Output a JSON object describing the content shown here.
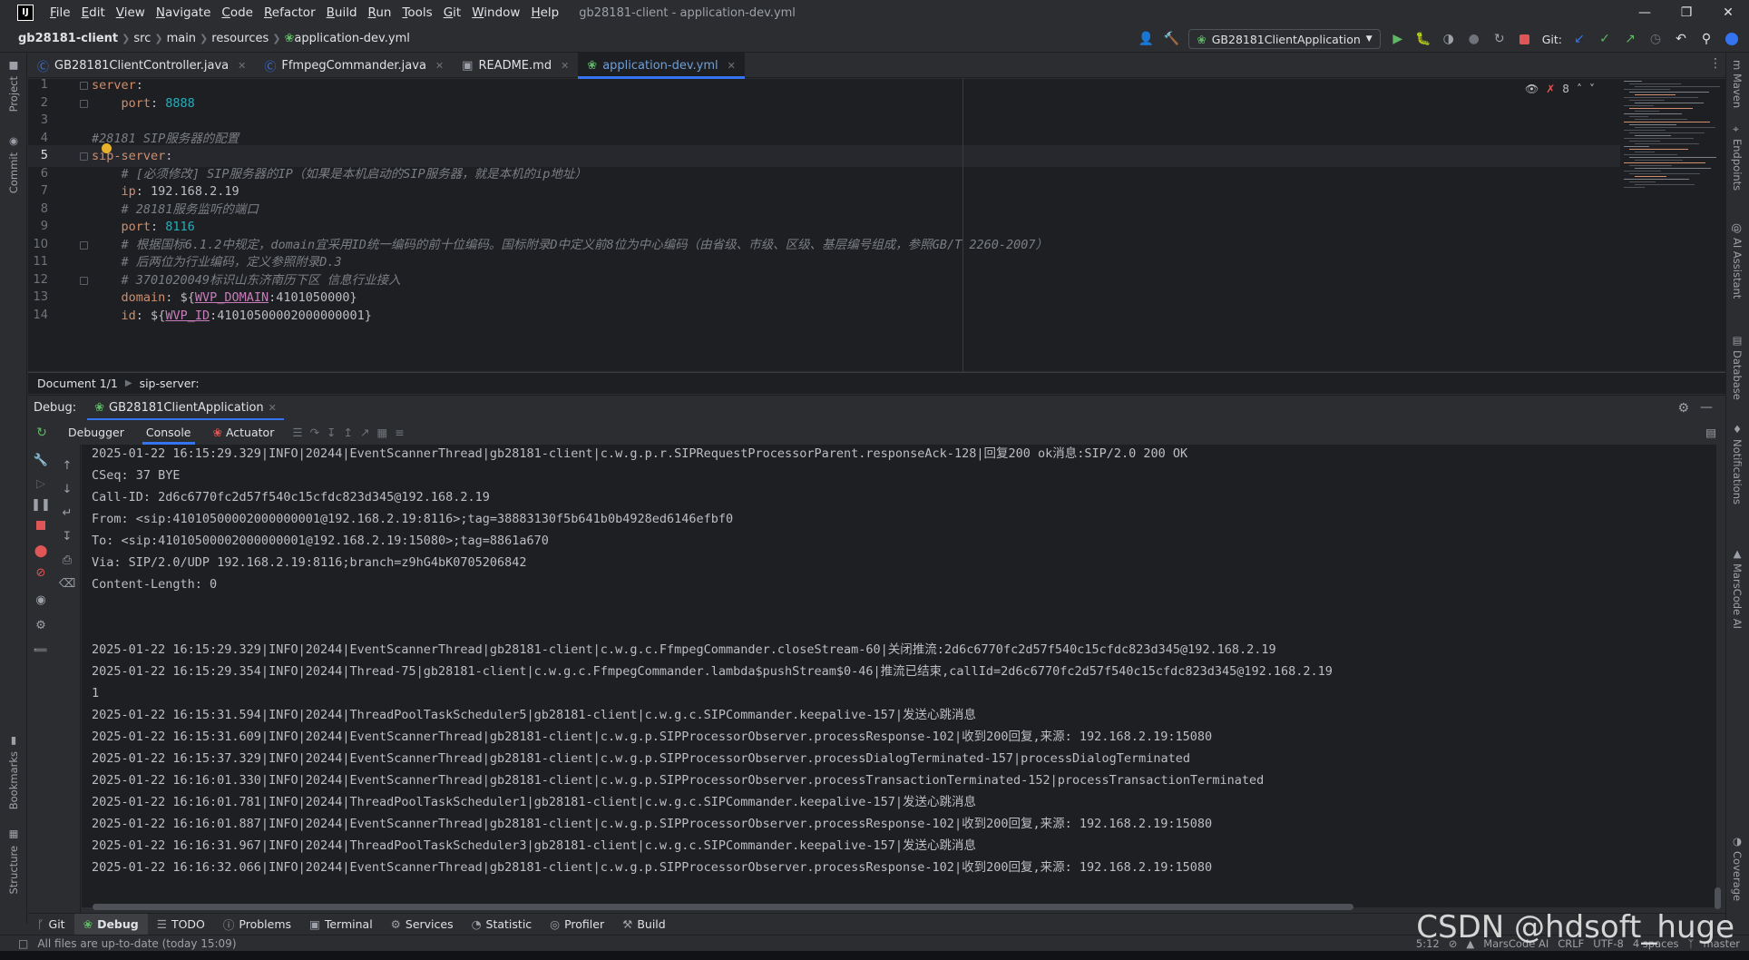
{
  "app": {
    "window_title": "gb28181-client - application-dev.yml",
    "logo_text": "IJ"
  },
  "menu": [
    "File",
    "Edit",
    "View",
    "Navigate",
    "Code",
    "Refactor",
    "Build",
    "Run",
    "Tools",
    "Git",
    "Window",
    "Help"
  ],
  "breadcrumb": [
    "gb28181-client",
    "src",
    "main",
    "resources",
    "application-dev.yml"
  ],
  "toolbar": {
    "run_config": "GB28181ClientApplication",
    "git_label": "Git:"
  },
  "left_stripe": {
    "project": "Project",
    "commit": "Commit",
    "bookmarks": "Bookmarks",
    "structure": "Structure"
  },
  "right_stripe": {
    "maven": "Maven",
    "endpoints": "Endpoints",
    "ai_assistant": "AI Assistant",
    "database": "Database",
    "notifications": "Notifications",
    "marscode": "MarsCode AI",
    "coverage": "Coverage"
  },
  "editor_tabs": [
    {
      "name": "GB28181ClientController.java",
      "active": false
    },
    {
      "name": "FfmpegCommander.java",
      "active": false
    },
    {
      "name": "README.md",
      "active": false
    },
    {
      "name": "application-dev.yml",
      "active": true
    }
  ],
  "editor": {
    "inspection_count": "8",
    "line_numbers": [
      "1",
      "2",
      "3",
      "4",
      "5",
      "6",
      "7",
      "8",
      "9",
      "10",
      "11",
      "12",
      "13",
      "14"
    ],
    "lines": [
      {
        "key": "server",
        "sep": ":",
        "val": "",
        "comment": ""
      },
      {
        "indent": "    ",
        "key": "port",
        "sep": ": ",
        "num": "8888"
      },
      {},
      {
        "comment": "#28181 SIP服务器的配置"
      },
      {
        "key": "sip-server",
        "sep": ":"
      },
      {
        "indent": "    ",
        "comment": "# [必须修改] SIP服务器的IP（如果是本机启动的SIP服务器，就是本机的ip地址）"
      },
      {
        "indent": "    ",
        "key": "ip",
        "sep": ": ",
        "val": "192.168.2.19"
      },
      {
        "indent": "    ",
        "comment": "# 28181服务监听的端口"
      },
      {
        "indent": "    ",
        "key": "port",
        "sep": ": ",
        "num": "8116"
      },
      {
        "indent": "    ",
        "comment": "# 根据国标6.1.2中规定，domain宜采用ID统一编码的前十位编码。国标附录D中定义前8位为中心编码（由省级、市级、区级、基层编号组成，参照GB/T 2260-2007）"
      },
      {
        "indent": "    ",
        "comment": "# 后两位为行业编码，定义参照附录D.3"
      },
      {
        "indent": "    ",
        "comment": "# 3701020049标识山东济南历下区 信息行业接入"
      },
      {
        "indent": "    ",
        "key": "domain",
        "sep": ": ",
        "pre": "${",
        "env": "WVP_DOMAIN",
        "post": ":4101050000}"
      },
      {
        "indent": "    ",
        "key": "id",
        "sep": ": ",
        "pre": "${",
        "env": "WVP_ID",
        "post": ":41010500002000000001}"
      }
    ]
  },
  "doc_strip": {
    "doc": "Document 1/1",
    "path": "sip-server:"
  },
  "debug": {
    "label": "Debug:",
    "session": "GB28181ClientApplication",
    "subtabs": [
      "Debugger",
      "Console",
      "Actuator"
    ],
    "console_lines": [
      "2025-01-22 16:15:29.329|INFO|20244|EventScannerThread|gb28181-client|c.w.g.p.r.SIPRequestProcessorParent.responseAck-128|回复200 ok消息:SIP/2.0 200 OK",
      "CSeq: 37 BYE",
      "Call-ID: 2d6c6770fc2d57f540c15cfdc823d345@192.168.2.19",
      "From: <sip:41010500002000000001@192.168.2.19:8116>;tag=38883130f5b641b0b4928ed6146efbf0",
      "To: <sip:41010500002000000001@192.168.2.19:15080>;tag=8861a670",
      "Via: SIP/2.0/UDP 192.168.2.19:8116;branch=z9hG4bK0705206842",
      "Content-Length: 0",
      "",
      "",
      "2025-01-22 16:15:29.329|INFO|20244|EventScannerThread|gb28181-client|c.w.g.c.FfmpegCommander.closeStream-60|关闭推流:2d6c6770fc2d57f540c15cfdc823d345@192.168.2.19",
      "2025-01-22 16:15:29.354|INFO|20244|Thread-75|gb28181-client|c.w.g.c.FfmpegCommander.lambda$pushStream$0-46|推流已结束,callId=2d6c6770fc2d57f540c15cfdc823d345@192.168.2.19",
      "1",
      "2025-01-22 16:15:31.594|INFO|20244|ThreadPoolTaskScheduler5|gb28181-client|c.w.g.c.SIPCommander.keepalive-157|发送心跳消息",
      "2025-01-22 16:15:31.609|INFO|20244|EventScannerThread|gb28181-client|c.w.g.p.SIPProcessorObserver.processResponse-102|收到200回复,来源: 192.168.2.19:15080",
      "2025-01-22 16:15:37.329|INFO|20244|EventScannerThread|gb28181-client|c.w.g.p.SIPProcessorObserver.processDialogTerminated-157|processDialogTerminated",
      "2025-01-22 16:16:01.330|INFO|20244|EventScannerThread|gb28181-client|c.w.g.p.SIPProcessorObserver.processTransactionTerminated-152|processTransactionTerminated",
      "2025-01-22 16:16:01.781|INFO|20244|ThreadPoolTaskScheduler1|gb28181-client|c.w.g.c.SIPCommander.keepalive-157|发送心跳消息",
      "2025-01-22 16:16:01.887|INFO|20244|EventScannerThread|gb28181-client|c.w.g.p.SIPProcessorObserver.processResponse-102|收到200回复,来源: 192.168.2.19:15080",
      "2025-01-22 16:16:31.967|INFO|20244|ThreadPoolTaskScheduler3|gb28181-client|c.w.g.c.SIPCommander.keepalive-157|发送心跳消息",
      "2025-01-22 16:16:32.066|INFO|20244|EventScannerThread|gb28181-client|c.w.g.p.SIPProcessorObserver.processResponse-102|收到200回复,来源: 192.168.2.19:15080"
    ]
  },
  "bottom_tools": [
    "Git",
    "Debug",
    "TODO",
    "Problems",
    "Terminal",
    "Services",
    "Statistic",
    "Profiler",
    "Build"
  ],
  "status": {
    "message": "All files are up-to-date (today 15:09)",
    "position": "5:12",
    "ai": "MarsCode AI",
    "line_sep": "CRLF",
    "encoding": "UTF-8",
    "indent": "4 spaces",
    "branch": "master"
  },
  "watermark": "CSDN @hdsoft_huge",
  "colors": {
    "accent": "#3574f0",
    "keyword": "#cf8e6d",
    "number": "#2aacb8",
    "comment": "#7a7e85",
    "env": "#c77dbb"
  }
}
